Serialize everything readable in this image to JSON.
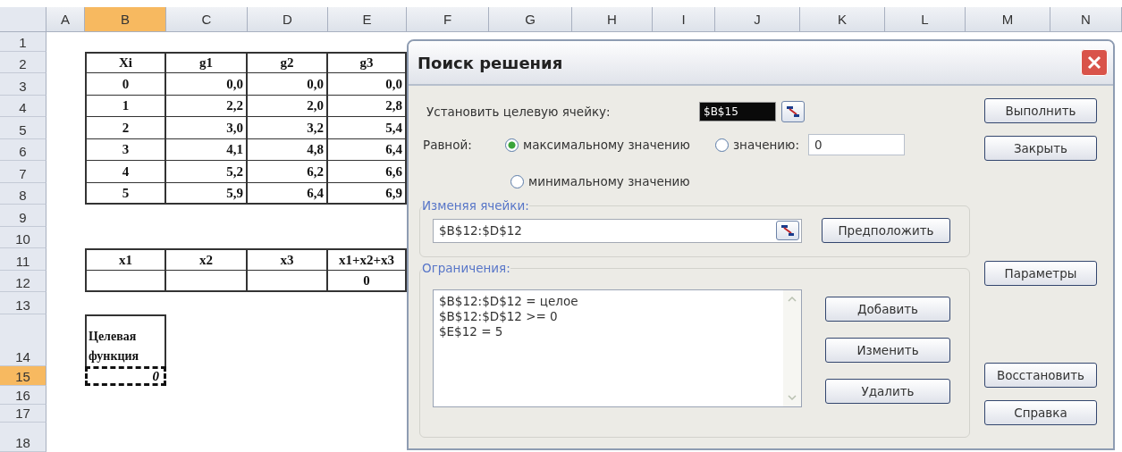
{
  "sheet": {
    "columns": [
      {
        "label": "A",
        "selected": false
      },
      {
        "label": "B",
        "selected": true
      },
      {
        "label": "C",
        "selected": false
      },
      {
        "label": "D",
        "selected": false
      },
      {
        "label": "E",
        "selected": false
      },
      {
        "label": "F",
        "selected": false
      },
      {
        "label": "G",
        "selected": false
      },
      {
        "label": "H",
        "selected": false
      },
      {
        "label": "I",
        "selected": false
      },
      {
        "label": "J",
        "selected": false
      },
      {
        "label": "K",
        "selected": false
      },
      {
        "label": "L",
        "selected": false
      },
      {
        "label": "M",
        "selected": false
      },
      {
        "label": "N",
        "selected": false
      }
    ],
    "rows": [
      {
        "label": "1",
        "selected": false
      },
      {
        "label": "2",
        "selected": false
      },
      {
        "label": "3",
        "selected": false
      },
      {
        "label": "4",
        "selected": false
      },
      {
        "label": "5",
        "selected": false
      },
      {
        "label": "6",
        "selected": false
      },
      {
        "label": "7",
        "selected": false
      },
      {
        "label": "8",
        "selected": false
      },
      {
        "label": "9",
        "selected": false
      },
      {
        "label": "10",
        "selected": false
      },
      {
        "label": "11",
        "selected": false
      },
      {
        "label": "12",
        "selected": false
      },
      {
        "label": "13",
        "selected": false
      },
      {
        "label": "14",
        "selected": false
      },
      {
        "label": "15",
        "selected": true
      },
      {
        "label": "16",
        "selected": false
      },
      {
        "label": "17",
        "selected": false
      },
      {
        "label": "18",
        "selected": false
      }
    ],
    "table_1": {
      "columns": [
        "Xi",
        "g1",
        "g2",
        "g3"
      ],
      "rows": [
        [
          "0",
          "0,0",
          "0,0",
          "0,0"
        ],
        [
          "1",
          "2,2",
          "2,0",
          "2,8"
        ],
        [
          "2",
          "3,0",
          "3,2",
          "5,4"
        ],
        [
          "3",
          "4,1",
          "4,8",
          "6,4"
        ],
        [
          "4",
          "5,2",
          "6,2",
          "6,6"
        ],
        [
          "5",
          "5,9",
          "6,4",
          "6,9"
        ]
      ]
    },
    "table_2": {
      "columns": [
        "x1",
        "x2",
        "x3",
        "x1+x2+x3"
      ],
      "rows": [
        [
          null,
          null,
          null,
          "0"
        ]
      ]
    },
    "objective": {
      "label": "Целевая функция",
      "value": "0",
      "active": true
    }
  },
  "dialog": {
    "title": "Поиск решения",
    "target_label": "Установить целевую ячейку:",
    "target_value": "$B$15",
    "target_highlighted": true,
    "equal_label": "Равной:",
    "options": [
      {
        "label": "максимальному значению",
        "selected": true
      },
      {
        "label": "значению:",
        "selected": false
      },
      {
        "label": "минимальному значению",
        "selected": false
      }
    ],
    "value_field": "0",
    "changing_legend": "Изменяя ячейки:",
    "changing_value": "$B$12:$D$12",
    "guess_button": "Предположить",
    "constraints_legend": "Ограничения:",
    "constraints": [
      "$B$12:$D$12 = целое",
      "$B$12:$D$12 >= 0",
      "$E$12 = 5"
    ],
    "constraint_buttons": [
      "Добавить",
      "Изменить",
      "Удалить"
    ],
    "side_buttons": [
      "Выполнить",
      "Закрыть",
      "Параметры",
      "Восстановить",
      "Справка"
    ]
  }
}
